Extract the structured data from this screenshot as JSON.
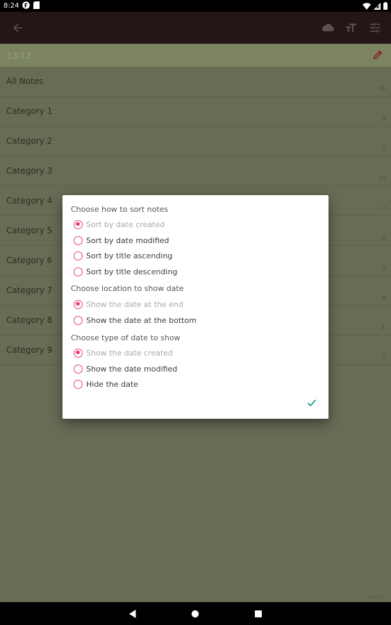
{
  "status": {
    "time": "8:24"
  },
  "header": {
    "count": "13/12"
  },
  "categories": [
    {
      "name": "All Notes",
      "count": "30"
    },
    {
      "name": "Category 1",
      "count": "3"
    },
    {
      "name": "Category 2",
      "count": "2"
    },
    {
      "name": "Category 3",
      "count": "12"
    },
    {
      "name": "Category 4",
      "count": "3"
    },
    {
      "name": "Category 5",
      "count": "0"
    },
    {
      "name": "Category 6",
      "count": "3"
    },
    {
      "name": "Category 7",
      "count": "4"
    },
    {
      "name": "Category 8",
      "count": "1"
    },
    {
      "name": "Category 9",
      "count": "0"
    }
  ],
  "version": "v021.5",
  "dialog": {
    "sort_title": "Choose how to sort notes",
    "sort_options": [
      "Sort by date created",
      "Sort by date modified",
      "Sort by title ascending",
      "Sort by title descending"
    ],
    "sort_selected": "Sort by date created",
    "location_title": "Choose location to show date",
    "location_options": [
      "Show the date at the end",
      "Show the date at the bottom"
    ],
    "location_selected": "Show the date at the end",
    "type_title": "Choose type of date to show",
    "type_options": [
      "Show the date created",
      "Show the date modified",
      "Hide the date"
    ],
    "type_selected": "Show the date created"
  },
  "colors": {
    "accent": "#e5407d",
    "confirm": "#1a9b86",
    "app_bar": "#241516",
    "scrim_content": "#6a6b55"
  },
  "icons": {
    "back": "arrow-back-icon",
    "cloud": "cloud-icon",
    "text_size": "text-size-icon",
    "sort": "sort-settings-icon",
    "edit": "pencil-icon",
    "confirm": "check-icon"
  }
}
